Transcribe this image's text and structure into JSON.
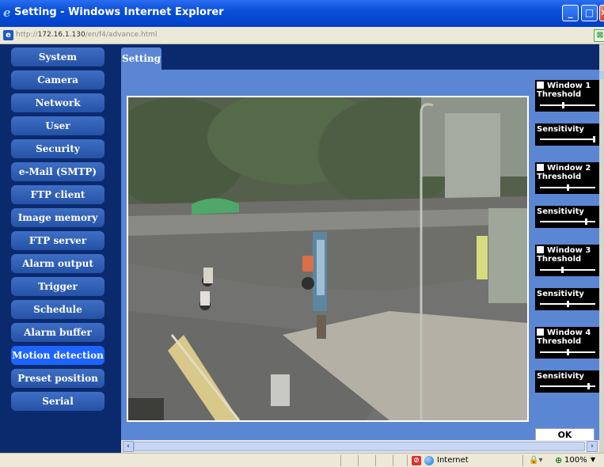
{
  "window": {
    "title": "Setting - Windows Internet Explorer",
    "url_prefix": "http://",
    "url_host": "172.16.1.130",
    "url_path": "/en/f4/advance.html",
    "min_label": "_",
    "max_label": "□",
    "close_label": "✕"
  },
  "sidebar": {
    "items": [
      {
        "label": "System"
      },
      {
        "label": "Camera"
      },
      {
        "label": "Network"
      },
      {
        "label": "User"
      },
      {
        "label": "Security"
      },
      {
        "label": "e-Mail (SMTP)"
      },
      {
        "label": "FTP client"
      },
      {
        "label": "Image memory"
      },
      {
        "label": "FTP server"
      },
      {
        "label": "Alarm output"
      },
      {
        "label": "Trigger"
      },
      {
        "label": "Schedule"
      },
      {
        "label": "Alarm buffer"
      },
      {
        "label": "Motion detection",
        "active": true
      },
      {
        "label": "Preset position"
      },
      {
        "label": "Serial"
      }
    ]
  },
  "tab": {
    "label": "Setting"
  },
  "motion": {
    "windows": [
      {
        "label": "Window 1",
        "enabled": false,
        "threshold_label": "Threshold",
        "threshold": 0.42,
        "sensitivity_label": "Sensitivity",
        "sensitivity": 1.0
      },
      {
        "label": "Window 2",
        "enabled": false,
        "threshold_label": "Threshold",
        "threshold": 0.5,
        "sensitivity_label": "Sensitivity",
        "sensitivity": 0.85
      },
      {
        "label": "Window 3",
        "enabled": false,
        "threshold_label": "Threshold",
        "threshold": 0.4,
        "sensitivity_label": "Sensitivity",
        "sensitivity": 0.5
      },
      {
        "label": "Window 4",
        "enabled": false,
        "threshold_label": "Threshold",
        "threshold": 0.5,
        "sensitivity_label": "Sensitivity",
        "sensitivity": 0.9
      }
    ],
    "ok_label": "OK"
  },
  "statusbar": {
    "zone": "Internet",
    "zoom": "100%"
  },
  "colors": {
    "page_background": "#0b2a6e",
    "content_background": "#5b86d3",
    "nav_button": "#2d5db3",
    "nav_active": "#1e64ff",
    "titlebar": "#0a4fd9"
  },
  "icons": {
    "browser": "ie-icon",
    "page": "page-icon",
    "blocked": "popup-blocked-icon",
    "zone": "globe-icon",
    "zoom": "magnifier-icon"
  }
}
